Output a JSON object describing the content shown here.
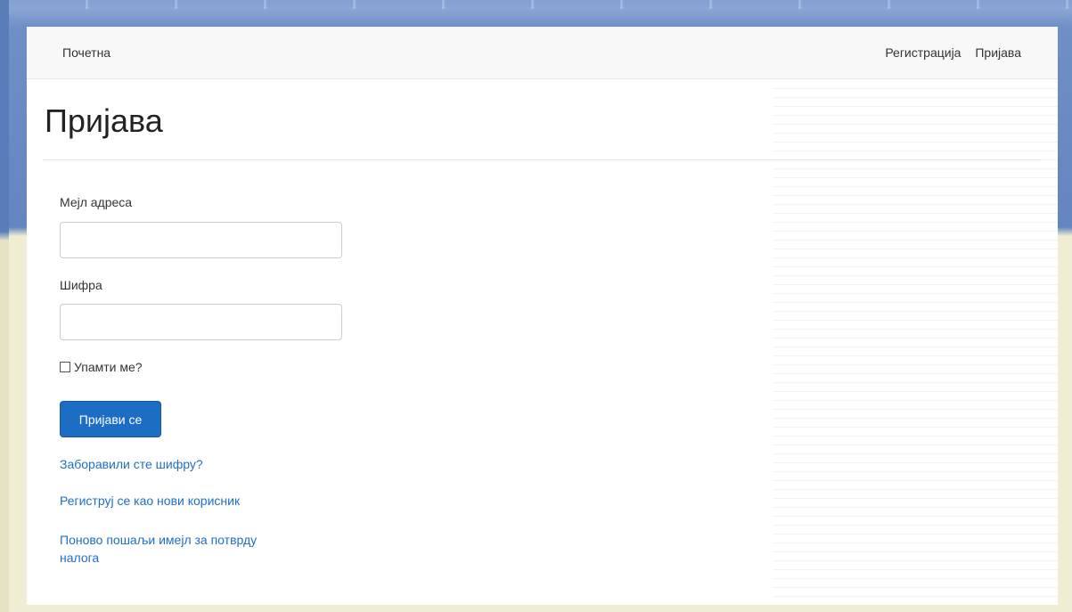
{
  "navbar": {
    "brand": "Почетна",
    "links": [
      {
        "label": "Регистрација"
      },
      {
        "label": "Пријава"
      }
    ]
  },
  "page": {
    "title": "Пријава"
  },
  "form": {
    "email_label": "Мејл адреса",
    "email_value": "",
    "password_label": "Шифра",
    "password_value": "",
    "remember_label": "Упамти ме?",
    "remember_checked": false,
    "submit_label": "Пријави се"
  },
  "links": {
    "forgot_password": "Заборавили сте шифру?",
    "register_new": "Региструј се као нови корисник",
    "resend_confirmation_line1": "Поново пошаљи имејл за потврду",
    "resend_confirmation_line2": "налога"
  },
  "colors": {
    "primary": "#1c6dc4",
    "link": "#1f6fc5",
    "navbar_bg": "#f8f8f8"
  }
}
